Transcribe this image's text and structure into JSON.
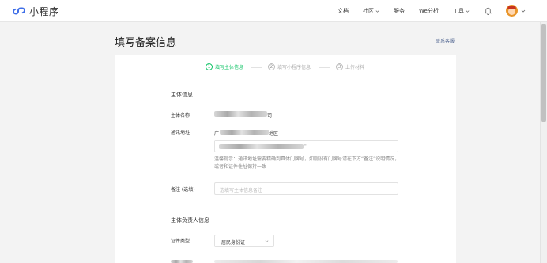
{
  "app": {
    "title": "小程序"
  },
  "nav": {
    "items": [
      {
        "label": "文档",
        "dropdown": false
      },
      {
        "label": "社区",
        "dropdown": true
      },
      {
        "label": "服务",
        "dropdown": false
      },
      {
        "label": "We分析",
        "dropdown": false
      },
      {
        "label": "工具",
        "dropdown": true
      }
    ]
  },
  "page": {
    "title": "填写备案信息",
    "service_link": "联系客服"
  },
  "steps": [
    {
      "num": "1",
      "label": "填写主体信息",
      "state": "active"
    },
    {
      "num": "2",
      "label": "填写小程序信息",
      "state": "inactive"
    },
    {
      "num": "3",
      "label": "上传材料",
      "state": "inactive"
    }
  ],
  "subject": {
    "section_title": "主体信息",
    "name_label": "主体名称",
    "name_suffix": "司",
    "address_label": "通讯地址",
    "address_prefix": "广",
    "address_suffix": "地区",
    "address_detail_suffix": "\"",
    "address_hint": "温馨提示：通讯地址需要精确到具体门牌号，如刚没有门牌号请在下方“备注”说明情况，或者和证件住址保持一致",
    "remark_label": "备注 (选填)",
    "remark_placeholder": "选填写主体信息备注"
  },
  "principal": {
    "section_title": "主体负责人信息",
    "id_type_label": "证件类型",
    "id_type_value": "居民身份证"
  },
  "colors": {
    "brand_green": "#07c160",
    "link_blue": "#576b95",
    "logo_blue": "#3e6ee8"
  }
}
